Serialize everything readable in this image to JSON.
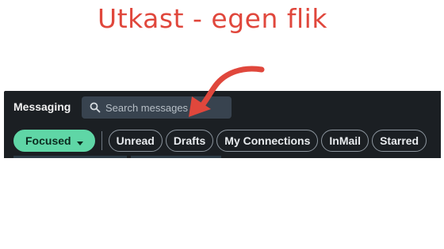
{
  "annotation": {
    "headline": "Utkast - egen flik",
    "headline_color": "#e0473c",
    "arrow_color": "#e0473c",
    "arrow_icon": "curved-arrow-icon"
  },
  "header": {
    "title": "Messaging"
  },
  "search": {
    "icon": "search-icon",
    "placeholder": "Search messages"
  },
  "filters": {
    "focused": {
      "label": "Focused",
      "icon": "caret-down-icon",
      "color": "#5fd6a6"
    },
    "pills": [
      {
        "label": "Unread"
      },
      {
        "label": "Drafts"
      },
      {
        "label": "My Connections"
      },
      {
        "label": "InMail"
      },
      {
        "label": "Starred"
      }
    ]
  }
}
